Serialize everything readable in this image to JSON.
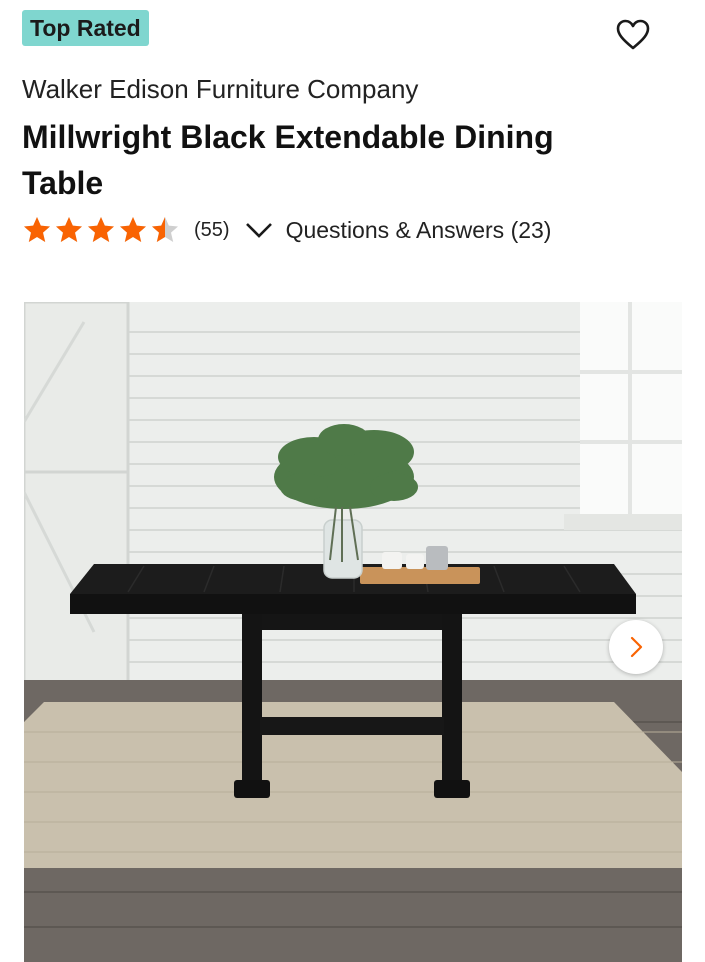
{
  "badge": {
    "label": "Top Rated"
  },
  "product": {
    "brand": "Walker Edison Furniture Company",
    "title": "Millwright Black Extendable Dining Table"
  },
  "rating": {
    "stars": 4.5,
    "max_stars": 5,
    "count_label": "(55)",
    "qa_label": "Questions & Answers (23)"
  },
  "icons": {
    "favorite": "heart-outline-icon",
    "expand": "chevron-down-icon",
    "next": "chevron-right-icon"
  },
  "colors": {
    "badge_bg": "#7fd6cf",
    "star": "#f96302",
    "next_arrow": "#f96302"
  }
}
